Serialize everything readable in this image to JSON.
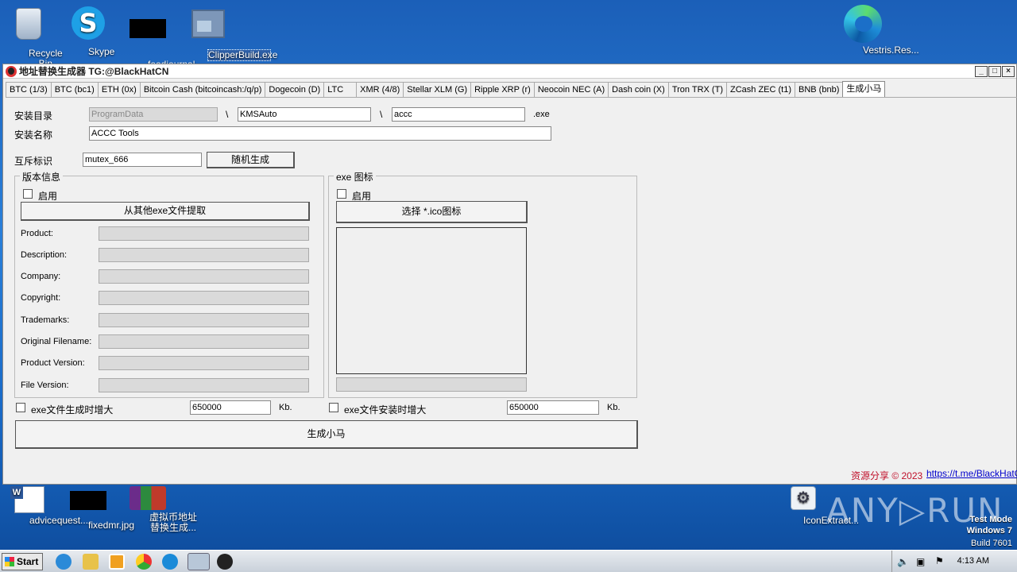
{
  "desktop": {
    "top_icons": [
      {
        "label": "Recycle Bin",
        "icon": "recycle-bin-icon"
      },
      {
        "label": "Skype",
        "icon": "skype-icon"
      },
      {
        "label": "foodjournal...",
        "icon": "black-file-icon"
      },
      {
        "label": "ClipperBuild.exe",
        "icon": "exe-icon"
      },
      {
        "label": "Vestris.Res...",
        "icon": "edge-icon"
      }
    ],
    "bottom_icons": [
      {
        "label": "advicequest...",
        "icon": "word-doc-icon"
      },
      {
        "label": "fixedmr.jpg",
        "icon": "black-file-icon"
      },
      {
        "label": "虚拟币地址替换生成...",
        "icon": "winrar-icon"
      },
      {
        "label": "IconExtract...",
        "icon": "gear-icon"
      }
    ],
    "watermark": {
      "line1": "Test Mode",
      "line2": "Windows 7",
      "line3": "Build 7601",
      "brand": "ANY▷RUN"
    }
  },
  "window": {
    "title": "地址替换生成器 TG:@BlackHatCN",
    "controls": [
      "_",
      "□",
      "×"
    ],
    "tabs": [
      "BTC (1/3)",
      "BTC (bc1)",
      "ETH (0x)",
      "Bitcoin Cash (bitcoincash:/q/p)",
      "Dogecoin (D)",
      "LTC",
      "XMR (4/8)",
      "Stellar XLM (G)",
      "Ripple XRP (r)",
      "Neocoin NEC (A)",
      "Dash coin (X)",
      "Tron TRX (T)",
      "ZCash ZEC (t1)",
      "BNB (bnb)",
      "生成小马"
    ],
    "active_tab": "生成小马",
    "install_dir_label": "安装目录",
    "install_dir_base": "ProgramData",
    "separator": "\\",
    "install_dir_sub": "KMSAuto",
    "install_exe_name": "accc",
    "exe_ext": ".exe",
    "install_name_label": "安装名称",
    "install_name_value": "ACCC Tools",
    "mutex_label": "互斥标识",
    "mutex_value": "mutex_666",
    "random_button": "随机生成",
    "version_group": {
      "title": "版本信息",
      "enable_label": "启用",
      "extract_button": "从其他exe文件提取",
      "fields": [
        "Product:",
        "Description:",
        "Company:",
        "Copyright:",
        "Trademarks:",
        "Original Filename:",
        "Product Version:",
        "File Version:"
      ]
    },
    "icon_group": {
      "title": "exe 图标",
      "enable_label": "启用",
      "select_button": "选择 *.ico图标"
    },
    "enlarge_build_label": "exe文件生成时增大",
    "enlarge_build_value": "650000",
    "enlarge_install_label": "exe文件安装时增大",
    "enlarge_install_value": "650000",
    "kb_unit": "Kb.",
    "generate_button": "生成小马",
    "footer_text": "资源分享 © 2023",
    "footer_link": "https://t.me/BlackHatCN"
  },
  "taskbar": {
    "start_label": "Start",
    "clock": "4:13 AM"
  }
}
